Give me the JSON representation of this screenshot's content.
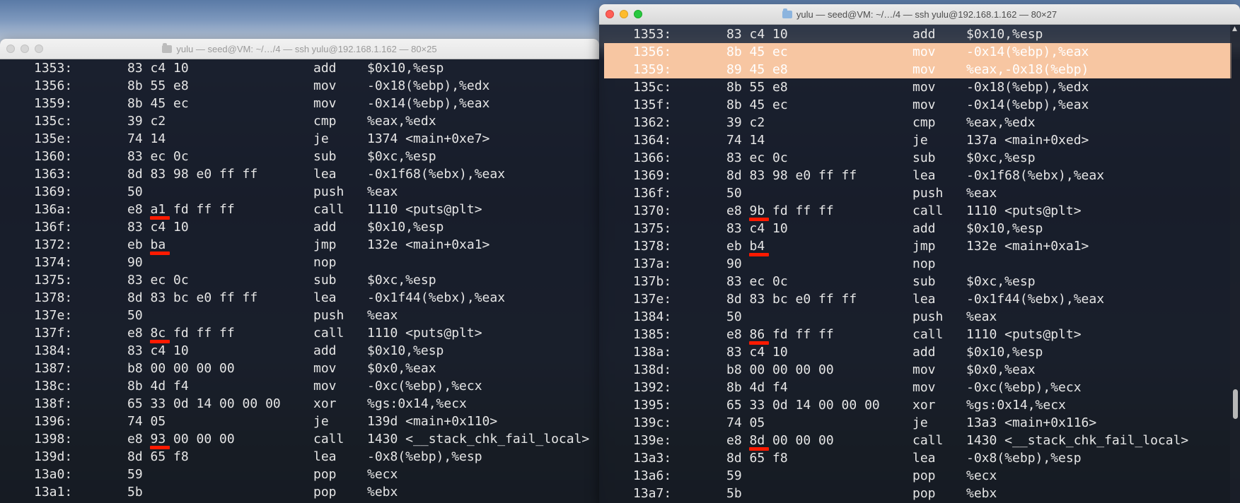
{
  "left_window": {
    "title": "yulu — seed@VM: ~/…/4 — ssh yulu@192.168.1.162 — 80×25",
    "lines": [
      {
        "addr": "1353:",
        "bytes": "83 c4 10",
        "op": "add",
        "args": "$0x10,%esp"
      },
      {
        "addr": "1356:",
        "bytes": "8b 55 e8",
        "op": "mov",
        "args": "-0x18(%ebp),%edx"
      },
      {
        "addr": "1359:",
        "bytes": "8b 45 ec",
        "op": "mov",
        "args": "-0x14(%ebp),%eax"
      },
      {
        "addr": "135c:",
        "bytes": "39 c2",
        "op": "cmp",
        "args": "%eax,%edx"
      },
      {
        "addr": "135e:",
        "bytes": "74 14",
        "op": "je",
        "args": "1374 <main+0xe7>"
      },
      {
        "addr": "1360:",
        "bytes": "83 ec 0c",
        "op": "sub",
        "args": "$0xc,%esp"
      },
      {
        "addr": "1363:",
        "bytes": "8d 83 98 e0 ff ff",
        "op": "lea",
        "args": "-0x1f68(%ebx),%eax"
      },
      {
        "addr": "1369:",
        "bytes": "50",
        "op": "push",
        "args": "%eax"
      },
      {
        "addr": "136a:",
        "bytes": "e8 a1 fd ff ff",
        "op": "call",
        "args": "1110 <puts@plt>",
        "mark": true
      },
      {
        "addr": "136f:",
        "bytes": "83 c4 10",
        "op": "add",
        "args": "$0x10,%esp"
      },
      {
        "addr": "1372:",
        "bytes": "eb ba",
        "op": "jmp",
        "args": "132e <main+0xa1>",
        "mark": true
      },
      {
        "addr": "1374:",
        "bytes": "90",
        "op": "nop",
        "args": ""
      },
      {
        "addr": "1375:",
        "bytes": "83 ec 0c",
        "op": "sub",
        "args": "$0xc,%esp"
      },
      {
        "addr": "1378:",
        "bytes": "8d 83 bc e0 ff ff",
        "op": "lea",
        "args": "-0x1f44(%ebx),%eax"
      },
      {
        "addr": "137e:",
        "bytes": "50",
        "op": "push",
        "args": "%eax"
      },
      {
        "addr": "137f:",
        "bytes": "e8 8c fd ff ff",
        "op": "call",
        "args": "1110 <puts@plt>",
        "mark": true
      },
      {
        "addr": "1384:",
        "bytes": "83 c4 10",
        "op": "add",
        "args": "$0x10,%esp"
      },
      {
        "addr": "1387:",
        "bytes": "b8 00 00 00 00",
        "op": "mov",
        "args": "$0x0,%eax"
      },
      {
        "addr": "138c:",
        "bytes": "8b 4d f4",
        "op": "mov",
        "args": "-0xc(%ebp),%ecx"
      },
      {
        "addr": "138f:",
        "bytes": "65 33 0d 14 00 00 00",
        "op": "xor",
        "args": "%gs:0x14,%ecx"
      },
      {
        "addr": "1396:",
        "bytes": "74 05",
        "op": "je",
        "args": "139d <main+0x110>"
      },
      {
        "addr": "1398:",
        "bytes": "e8 93 00 00 00",
        "op": "call",
        "args": "1430 <__stack_chk_fail_local>",
        "mark": true
      },
      {
        "addr": "139d:",
        "bytes": "8d 65 f8",
        "op": "lea",
        "args": "-0x8(%ebp),%esp"
      },
      {
        "addr": "13a0:",
        "bytes": "59",
        "op": "pop",
        "args": "%ecx"
      },
      {
        "addr": "13a1:",
        "bytes": "5b",
        "op": "pop",
        "args": "%ebx"
      }
    ]
  },
  "right_window": {
    "title": "yulu — seed@VM: ~/…/4 — ssh yulu@192.168.1.162 — 80×27",
    "lines": [
      {
        "addr": "1353:",
        "bytes": "83 c4 10",
        "op": "add",
        "args": "$0x10,%esp"
      },
      {
        "addr": "1356:",
        "bytes": "8b 45 ec",
        "op": "mov",
        "args": "-0x14(%ebp),%eax",
        "highlight": true
      },
      {
        "addr": "1359:",
        "bytes": "89 45 e8",
        "op": "mov",
        "args": "%eax,-0x18(%ebp)",
        "highlight": true
      },
      {
        "addr": "135c:",
        "bytes": "8b 55 e8",
        "op": "mov",
        "args": "-0x18(%ebp),%edx"
      },
      {
        "addr": "135f:",
        "bytes": "8b 45 ec",
        "op": "mov",
        "args": "-0x14(%ebp),%eax"
      },
      {
        "addr": "1362:",
        "bytes": "39 c2",
        "op": "cmp",
        "args": "%eax,%edx"
      },
      {
        "addr": "1364:",
        "bytes": "74 14",
        "op": "je",
        "args": "137a <main+0xed>"
      },
      {
        "addr": "1366:",
        "bytes": "83 ec 0c",
        "op": "sub",
        "args": "$0xc,%esp"
      },
      {
        "addr": "1369:",
        "bytes": "8d 83 98 e0 ff ff",
        "op": "lea",
        "args": "-0x1f68(%ebx),%eax"
      },
      {
        "addr": "136f:",
        "bytes": "50",
        "op": "push",
        "args": "%eax"
      },
      {
        "addr": "1370:",
        "bytes": "e8 9b fd ff ff",
        "op": "call",
        "args": "1110 <puts@plt>",
        "mark": true
      },
      {
        "addr": "1375:",
        "bytes": "83 c4 10",
        "op": "add",
        "args": "$0x10,%esp"
      },
      {
        "addr": "1378:",
        "bytes": "eb b4",
        "op": "jmp",
        "args": "132e <main+0xa1>",
        "mark": true
      },
      {
        "addr": "137a:",
        "bytes": "90",
        "op": "nop",
        "args": ""
      },
      {
        "addr": "137b:",
        "bytes": "83 ec 0c",
        "op": "sub",
        "args": "$0xc,%esp"
      },
      {
        "addr": "137e:",
        "bytes": "8d 83 bc e0 ff ff",
        "op": "lea",
        "args": "-0x1f44(%ebx),%eax"
      },
      {
        "addr": "1384:",
        "bytes": "50",
        "op": "push",
        "args": "%eax"
      },
      {
        "addr": "1385:",
        "bytes": "e8 86 fd ff ff",
        "op": "call",
        "args": "1110 <puts@plt>",
        "mark": true
      },
      {
        "addr": "138a:",
        "bytes": "83 c4 10",
        "op": "add",
        "args": "$0x10,%esp"
      },
      {
        "addr": "138d:",
        "bytes": "b8 00 00 00 00",
        "op": "mov",
        "args": "$0x0,%eax"
      },
      {
        "addr": "1392:",
        "bytes": "8b 4d f4",
        "op": "mov",
        "args": "-0xc(%ebp),%ecx"
      },
      {
        "addr": "1395:",
        "bytes": "65 33 0d 14 00 00 00",
        "op": "xor",
        "args": "%gs:0x14,%ecx"
      },
      {
        "addr": "139c:",
        "bytes": "74 05",
        "op": "je",
        "args": "13a3 <main+0x116>"
      },
      {
        "addr": "139e:",
        "bytes": "e8 8d 00 00 00",
        "op": "call",
        "args": "1430 <__stack_chk_fail_local>",
        "mark": true
      },
      {
        "addr": "13a3:",
        "bytes": "8d 65 f8",
        "op": "lea",
        "args": "-0x8(%ebp),%esp"
      },
      {
        "addr": "13a6:",
        "bytes": "59",
        "op": "pop",
        "args": "%ecx"
      },
      {
        "addr": "13a7:",
        "bytes": "5b",
        "op": "pop",
        "args": "%ebx"
      }
    ]
  },
  "colors": {
    "highlight": "#f7c6a2",
    "underline_mark": "#ff1a00",
    "terminal_text": "#e6e6e6"
  }
}
